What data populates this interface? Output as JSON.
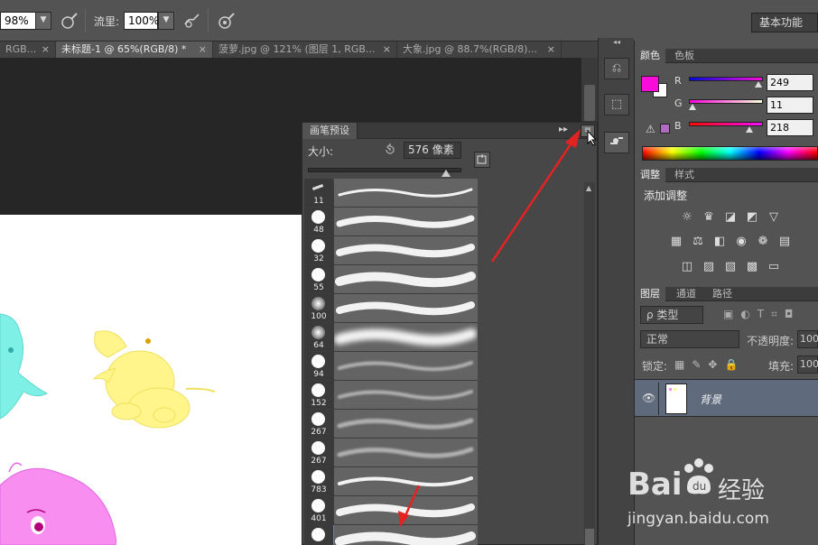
{
  "options_bar": {
    "opacity_value": "98%",
    "flow_label": "流里:",
    "flow_value": "100%",
    "workspace": "基本功能"
  },
  "doc_tabs": [
    {
      "label": "RGB...",
      "close": "×"
    },
    {
      "label": "未标题-1 @ 65%(RGB/8) *",
      "close": "×"
    },
    {
      "label": "菠萝.jpg @ 121% (图层 1, RGB...",
      "close": "×"
    },
    {
      "label": "大象.jpg @ 88.7%(RGB/8)...",
      "close": "×"
    }
  ],
  "brush_panel": {
    "tab": "画笔预设",
    "size_label": "大小:",
    "size_value": "576 像素",
    "expand_glyph": "▸▸",
    "menu_glyph": "≡",
    "brushes": [
      {
        "size": "11"
      },
      {
        "size": "48"
      },
      {
        "size": "32"
      },
      {
        "size": "55"
      },
      {
        "size": "100"
      },
      {
        "size": "64"
      },
      {
        "size": "94"
      },
      {
        "size": "152"
      },
      {
        "size": "267"
      },
      {
        "size": "267"
      },
      {
        "size": "783"
      },
      {
        "size": "401"
      },
      {
        "size": ""
      }
    ]
  },
  "dock": {
    "collapse_glyph": "◂◂"
  },
  "color_panel": {
    "tabs": [
      "颜色",
      "色板"
    ],
    "channels": [
      {
        "label": "R",
        "value": "249"
      },
      {
        "label": "G",
        "value": "11"
      },
      {
        "label": "B",
        "value": "218"
      }
    ],
    "foreground": "#f90bda",
    "warning_glyph": "⚠"
  },
  "adjust_panel": {
    "tabs": [
      "调整",
      "样式"
    ],
    "title": "添加调整"
  },
  "layers_panel": {
    "tabs": [
      "图层",
      "通道",
      "路径"
    ],
    "filter_label": "ρ 类型",
    "blend_mode": "正常",
    "opacity_label": "不透明度:",
    "opacity_value": "100",
    "lock_label": "锁定:",
    "fill_label": "填充:",
    "fill_value": "100",
    "layer_name": "背景"
  },
  "watermark": {
    "brand": "Bai",
    "brand_cn": "经验",
    "url": "jingyan.baidu.com"
  }
}
